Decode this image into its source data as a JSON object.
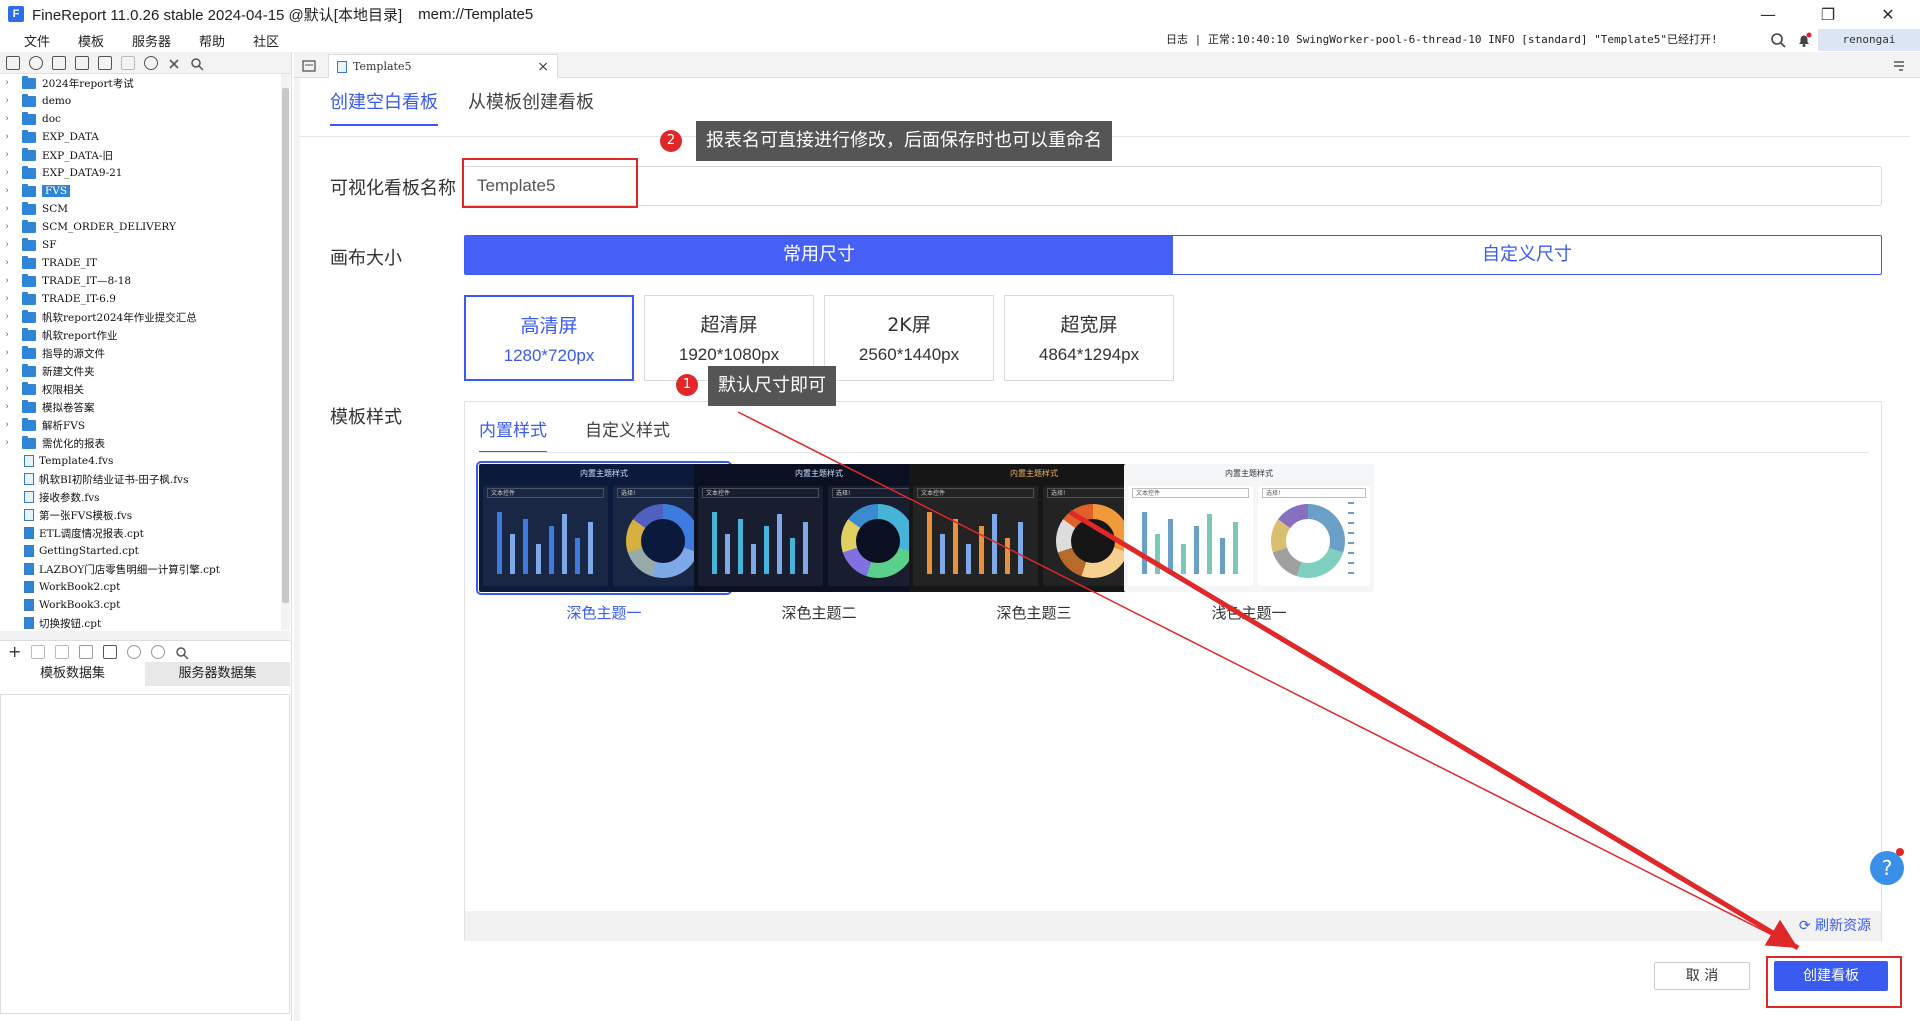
{
  "window": {
    "app_title": "FineReport 11.0.26 stable 2024-04-15 @默认[本地目录]",
    "file_path": "mem://Template5",
    "minimize": "—",
    "maximize": "❐",
    "close": "✕"
  },
  "menu": [
    "文件",
    "模板",
    "服务器",
    "帮助",
    "社区"
  ],
  "status_line": "日志 | 正常:10:40:10 SwingWorker-pool-6-thread-10 INFO [standard] \"Template5\"已经打开!",
  "user": "renongai",
  "tree": [
    {
      "type": "folder",
      "name": "2024年report考试"
    },
    {
      "type": "folder",
      "name": "demo"
    },
    {
      "type": "folder",
      "name": "doc"
    },
    {
      "type": "folder",
      "name": "EXP_DATA"
    },
    {
      "type": "folder",
      "name": "EXP_DATA-旧"
    },
    {
      "type": "folder",
      "name": "EXP_DATA9-21"
    },
    {
      "type": "folder",
      "name": "FVS",
      "selected": true
    },
    {
      "type": "folder",
      "name": "SCM"
    },
    {
      "type": "folder",
      "name": "SCM_ORDER_DELIVERY"
    },
    {
      "type": "folder",
      "name": "SF"
    },
    {
      "type": "folder",
      "name": "TRADE_IT"
    },
    {
      "type": "folder",
      "name": "TRADE_IT—8-18"
    },
    {
      "type": "folder",
      "name": "TRADE_IT-6.9"
    },
    {
      "type": "folder",
      "name": "帆软report2024年作业提交汇总"
    },
    {
      "type": "folder",
      "name": "帆软report作业"
    },
    {
      "type": "folder",
      "name": "指导的源文件"
    },
    {
      "type": "folder",
      "name": "新建文件夹"
    },
    {
      "type": "folder",
      "name": "权限相关"
    },
    {
      "type": "folder",
      "name": "模拟卷答案"
    },
    {
      "type": "folder",
      "name": "解析FVS"
    },
    {
      "type": "folder",
      "name": "需优化的报表"
    },
    {
      "type": "fvs",
      "name": "Template4.fvs"
    },
    {
      "type": "fvs",
      "name": "帆软BI初阶结业证书-田子枫.fvs"
    },
    {
      "type": "fvs",
      "name": "接收参数.fvs"
    },
    {
      "type": "fvs",
      "name": "第一张FVS模板.fvs"
    },
    {
      "type": "cpt",
      "name": "ETL调度情况报表.cpt"
    },
    {
      "type": "cpt",
      "name": "GettingStarted.cpt"
    },
    {
      "type": "cpt",
      "name": "LAZBOY门店零售明细一计算引擎.cpt"
    },
    {
      "type": "cpt",
      "name": "WorkBook2.cpt"
    },
    {
      "type": "cpt",
      "name": "WorkBook3.cpt"
    },
    {
      "type": "cpt",
      "name": "切换按钮.cpt"
    }
  ],
  "dataset_tabs": {
    "template": "模板数据集",
    "server": "服务器数据集"
  },
  "doc_tab": {
    "name": "Template5",
    "close": "×"
  },
  "dialog": {
    "tab_blank": "创建空白看板",
    "tab_from_template": "从模板创建看板",
    "name_label": "可视化看板名称",
    "name_value": "Template5",
    "canvas_label": "画布大小",
    "size_common": "常用尺寸",
    "size_custom": "自定义尺寸",
    "presets": [
      {
        "name": "高清屏",
        "res": "1280*720px",
        "active": true
      },
      {
        "name": "超清屏",
        "res": "1920*1080px"
      },
      {
        "name": "2K屏",
        "res": "2560*1440px"
      },
      {
        "name": "超宽屏",
        "res": "4864*1294px"
      }
    ],
    "style_label": "模板样式",
    "style_tab_builtin": "内置样式",
    "style_tab_custom": "自定义样式",
    "themes": [
      {
        "label": "深色主题一",
        "bg": "#0b1a3a",
        "accent": "#3e7be0",
        "active": true
      },
      {
        "label": "深色主题二",
        "bg": "#0a1022",
        "accent": "#46b3d8"
      },
      {
        "label": "深色主题三",
        "bg": "#161616",
        "accent": "#e8903a"
      },
      {
        "label": "浅色主题一",
        "bg": "#f4f6f8",
        "accent": "#6aa0c8"
      }
    ],
    "thumb_title": "内置主题样式",
    "thumb_filter1": "文本控件",
    "thumb_filter2": "选择!",
    "refresh": "刷新资源",
    "cancel": "取 消",
    "create": "创建看板"
  },
  "annotations": {
    "one_num": "1",
    "one_text": "默认尺寸即可",
    "two_num": "2",
    "two_text": "报表名可直接进行修改，后面保存时也可以重命名"
  },
  "help": "?",
  "colors": {
    "primary": "#3a5bf0",
    "annotation_red": "#e02828"
  }
}
